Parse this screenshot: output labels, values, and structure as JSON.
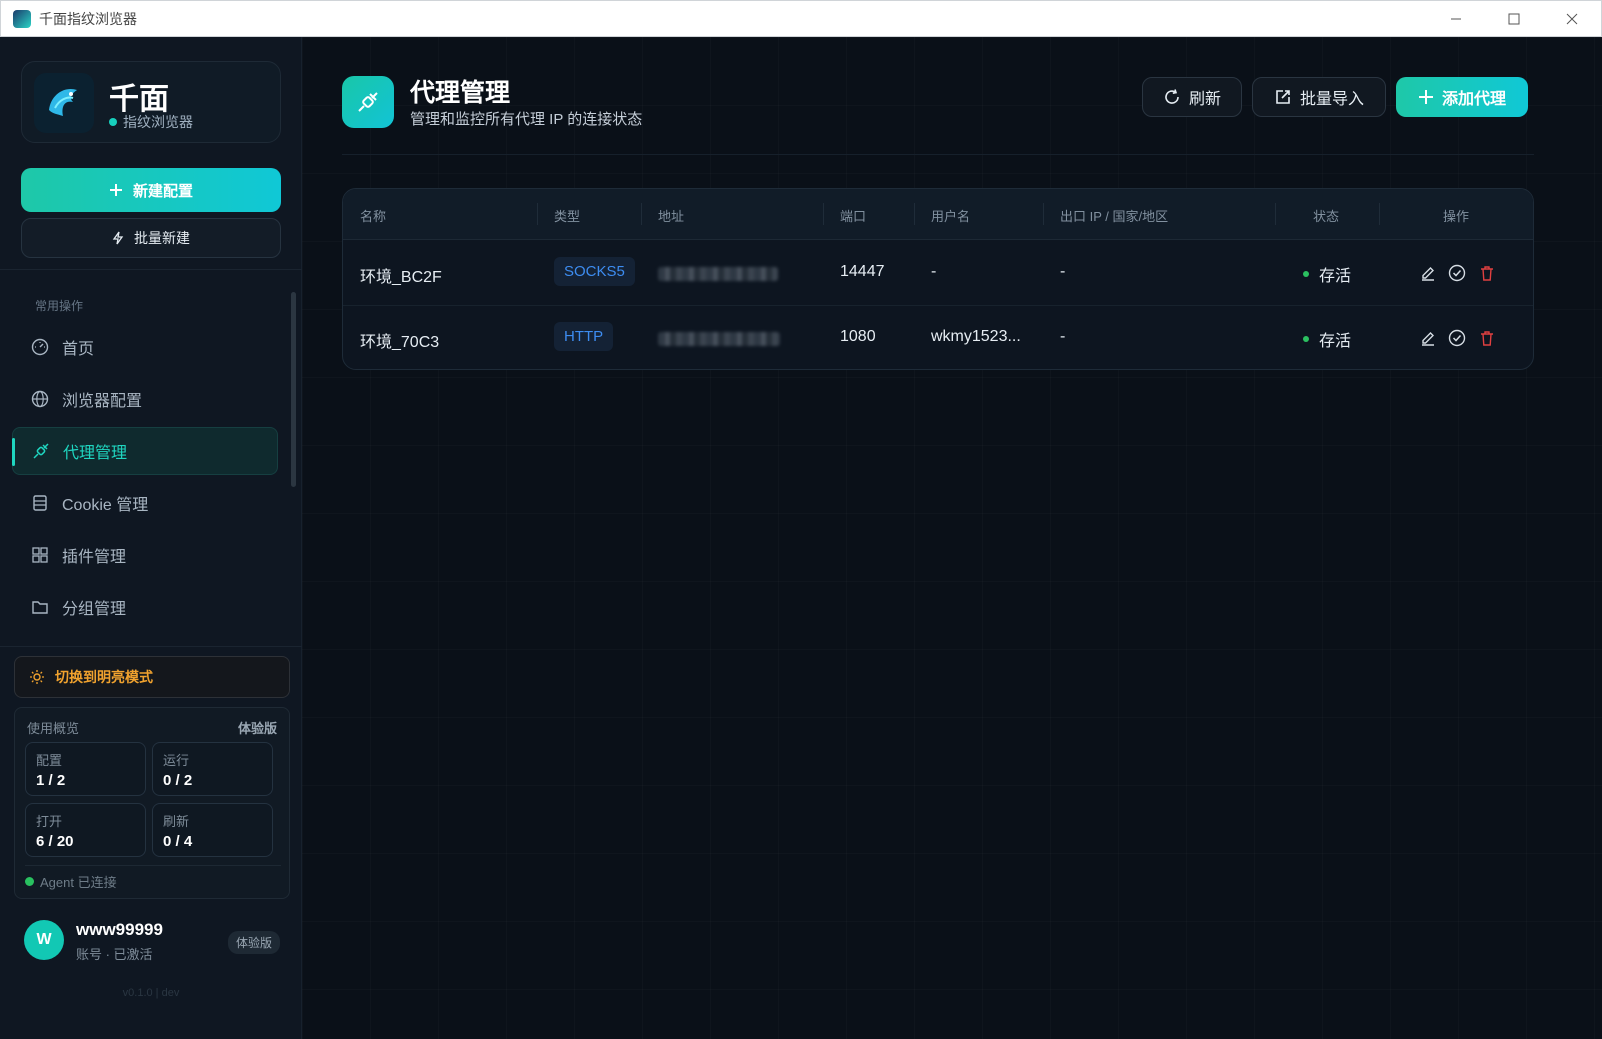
{
  "window": {
    "title": "千面指纹浏览器"
  },
  "brand": {
    "name": "千面",
    "subtitle": "指纹浏览器"
  },
  "sidebar": {
    "new_config": "新建配置",
    "batch_new": "批量新建",
    "section_label": "常用操作",
    "items": [
      {
        "label": "首页",
        "icon": "dashboard-icon"
      },
      {
        "label": "浏览器配置",
        "icon": "globe-icon"
      },
      {
        "label": "代理管理",
        "icon": "plug-icon",
        "active": true
      },
      {
        "label": "Cookie 管理",
        "icon": "cookie-icon"
      },
      {
        "label": "插件管理",
        "icon": "grid-icon"
      },
      {
        "label": "分组管理",
        "icon": "folder-icon"
      }
    ],
    "theme_toggle": "切换到明亮模式",
    "usage": {
      "title": "使用概览",
      "plan": "体验版",
      "stats": [
        {
          "label": "配置",
          "value": "1 / 2"
        },
        {
          "label": "运行",
          "value": "0 / 2"
        },
        {
          "label": "打开",
          "value": "6 / 20"
        },
        {
          "label": "刷新",
          "value": "0 / 4"
        }
      ],
      "agent": "Agent 已连接"
    },
    "user": {
      "initial": "W",
      "name": "www99999",
      "status": "账号 · 已激活",
      "badge": "体验版"
    },
    "version": "v0.1.0 | dev"
  },
  "page": {
    "title": "代理管理",
    "subtitle": "管理和监控所有代理 IP 的连接状态",
    "refresh": "刷新",
    "import": "批量导入",
    "add": "添加代理"
  },
  "table": {
    "headers": [
      "名称",
      "类型",
      "地址",
      "端口",
      "用户名",
      "出口 IP / 国家/地区",
      "状态",
      "操作"
    ],
    "rows": [
      {
        "name": "环境_BC2F",
        "type": "SOCKS5",
        "port": "14447",
        "username": "-",
        "exit_ip": "-",
        "status": "存活"
      },
      {
        "name": "环境_70C3",
        "type": "HTTP",
        "port": "1080",
        "username": "wkmy1523...",
        "exit_ip": "-",
        "status": "存活"
      }
    ]
  },
  "colors": {
    "accent": "#1fd6c0",
    "warning": "#f0a22e",
    "alive": "#2bc060",
    "tag": "#3d8cf0",
    "danger": "#e04040"
  }
}
